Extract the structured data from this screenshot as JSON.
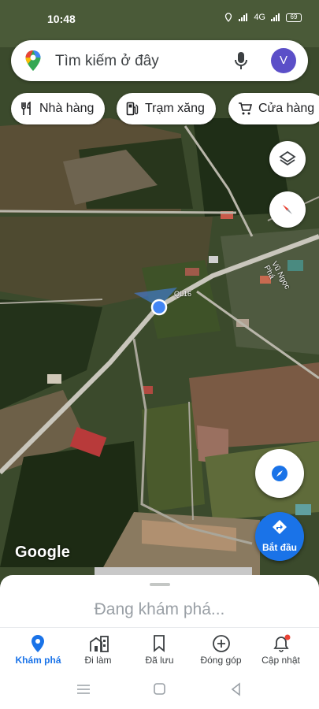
{
  "status": {
    "time": "10:48",
    "signal": "4G",
    "battery": "69"
  },
  "search": {
    "placeholder": "Tìm kiếm ở đây",
    "avatar_initial": "V"
  },
  "chips": [
    {
      "label": "Nhà hàng",
      "icon": "fork-knife-icon"
    },
    {
      "label": "Trạm xăng",
      "icon": "gas-station-icon"
    },
    {
      "label": "Cửa hàng",
      "icon": "shopping-cart-icon"
    }
  ],
  "map": {
    "road_labels": {
      "ql16": "QL16",
      "street": "Vũ Ngọc Phá"
    },
    "attribution": "Google",
    "controls": [
      "layers-icon",
      "compass-icon",
      "explore-icon"
    ],
    "start_label": "Bắt đầu"
  },
  "sheet": {
    "text": "Đang khám phá..."
  },
  "nav": {
    "active": "Khám phá",
    "items": [
      {
        "label": "Khám phá",
        "icon": "explore-pin-icon"
      },
      {
        "label": "Đi làm",
        "icon": "commute-icon"
      },
      {
        "label": "Đã lưu",
        "icon": "bookmark-icon"
      },
      {
        "label": "Đóng góp",
        "icon": "add-circle-icon"
      },
      {
        "label": "Cập nhật",
        "icon": "bell-icon"
      }
    ]
  },
  "colors": {
    "accent": "#1a73e8",
    "avatar": "#5b4fc8",
    "notification_dot": "#ea4335"
  }
}
